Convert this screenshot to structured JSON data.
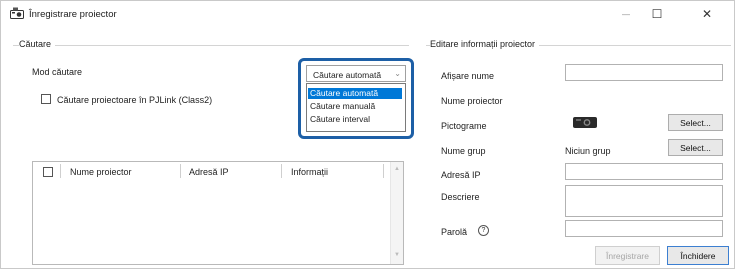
{
  "window": {
    "title": "Înregistrare proiector",
    "minimize_glyph": "—",
    "maximize_glyph": "☐",
    "close_glyph": "✕"
  },
  "search": {
    "group_title": "Căutare",
    "mode_label": "Mod căutare",
    "mode_selected": "Căutare automată",
    "mode_options": [
      "Căutare automată",
      "Căutare manuală",
      "Căutare interval"
    ],
    "pjlink_label": "Căutare proiectoare în PJLink (Class2)",
    "table_headers": [
      "Nume proiector",
      "Adresă IP",
      "Informații"
    ]
  },
  "edit": {
    "group_title": "Editare informații proiector",
    "display_name_label": "Afișare nume",
    "display_name_value": "",
    "projector_name_label": "Nume proiector",
    "icon_label": "Pictograme",
    "icon_select_button": "Select...",
    "group_name_label": "Nume grup",
    "group_name_value": "Niciun grup",
    "group_select_button": "Select...",
    "ip_label": "Adresă IP",
    "ip_value": "",
    "description_label": "Descriere",
    "description_value": "",
    "password_label": "Parolă",
    "help_glyph": "?",
    "password_value": ""
  },
  "footer": {
    "register_button": "Înregistrare",
    "close_button": "Închidere"
  }
}
